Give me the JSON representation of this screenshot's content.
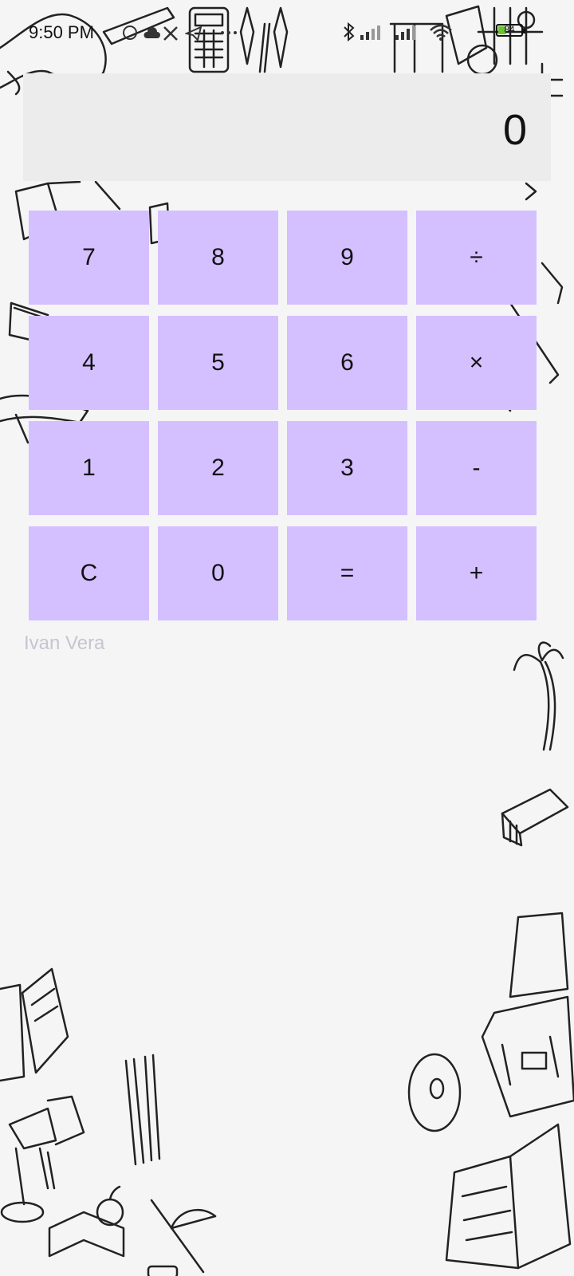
{
  "status_bar": {
    "time": "9:50 PM",
    "battery_level": "84",
    "icons": [
      "whatsapp-icon",
      "cloud-icon",
      "x-icon",
      "telegram-icon",
      "more-icon",
      "bluetooth-icon",
      "signal-icon",
      "signal-icon",
      "wifi-icon",
      "battery-icon"
    ]
  },
  "display": {
    "value": "0"
  },
  "keypad": {
    "rows": [
      [
        "7",
        "8",
        "9",
        "÷"
      ],
      [
        "4",
        "5",
        "6",
        "×"
      ],
      [
        "1",
        "2",
        "3",
        "-"
      ],
      [
        "C",
        "0",
        "=",
        "+"
      ]
    ],
    "key_color": "#d4bfff"
  },
  "footer": {
    "author": "Ivan Vera"
  }
}
